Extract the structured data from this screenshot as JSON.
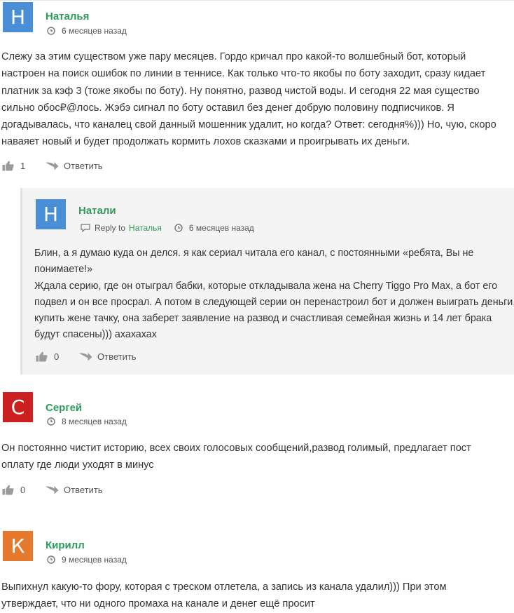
{
  "comments": [
    {
      "avatar_letter": "Н",
      "avatar_color": "#4a8fd6",
      "author": "Наталья",
      "time": "6 месяцев назад",
      "text_lines": [
        "Слежу за этим существом уже пару месяцев. Гордо кричал про какой-то волшебный бот, который",
        "настроен на поиск ошибок по линии в теннисе. Как только что-то якобы по боту заходит, сразу кидает",
        "платник за кэф 3 (тоже якобы по боту). Ну понятно, развод чистой воды. И сегодня 22 мая существо",
        "сильно обос₽@лось. Жэбэ сигнал по боту оставил без денег добрую половину подписчиков. Я",
        "догадывалась, что каналец свой данный мошенник удалит, но когда? Ответ: сегодня%))) Но, чую, скоро",
        "наваяет новый и будет продолжать кормить лохов сказками и проигрывать их деньги."
      ],
      "likes": "1",
      "reply_label": "Ответить"
    },
    {
      "avatar_letter": "С",
      "avatar_color": "#cc1f1f",
      "author": "Сергей",
      "time": "8 месяцев назад",
      "text_lines": [
        "Он постоянно чистит историю, всех своих голосовых сообщений,развод голимый, предлагает пост",
        "оплату где люди уходят в минус"
      ],
      "likes": "0",
      "reply_label": "Ответить"
    },
    {
      "avatar_letter": "К",
      "avatar_color": "#e57a2e",
      "author": "Кирилл",
      "time": "9 месяцев назад",
      "text_lines": [
        "Выпихнул какую-то фору, которая с треском отлетела, а запись из канала удалил))) При этом",
        "утверждает, что ни одного промаха на канале и денег ещё просит"
      ]
    }
  ],
  "reply": {
    "avatar_letter": "Н",
    "avatar_color": "#4a8fd6",
    "author": "Натали",
    "reply_to_label": "Reply to",
    "reply_to_name": "Наталья",
    "time": "6 месяцев назад",
    "text_lines": [
      "Блин, а я думаю куда он делся. я как сериал читала его канал, с постоянными «ребята, Вы не",
      "понимаете!»",
      "Ждала серию, где он отыграл бабки, которые откладывала жена на Cherry Tiggo Pro Max, а бот его",
      "подвел и он все просрал. А потом в следующей серии он перенастроил бот и должен выиграть деньги,",
      "купить жене тачку, она заберет заявление на развод и счастливая семейная жизнь и 14 лет брака",
      "будут спасены))) ахахахах"
    ],
    "likes": "0",
    "reply_label": "Ответить"
  },
  "icons": {
    "clock": "clock-icon",
    "like": "thumbs-up-icon",
    "reply": "reply-arrow-icon",
    "reply_to": "speech-bubble-icon"
  },
  "colors": {
    "author": "#2e9b5d",
    "icon_gray": "#9a9a9a",
    "reply_background": "#f4f4f4"
  }
}
